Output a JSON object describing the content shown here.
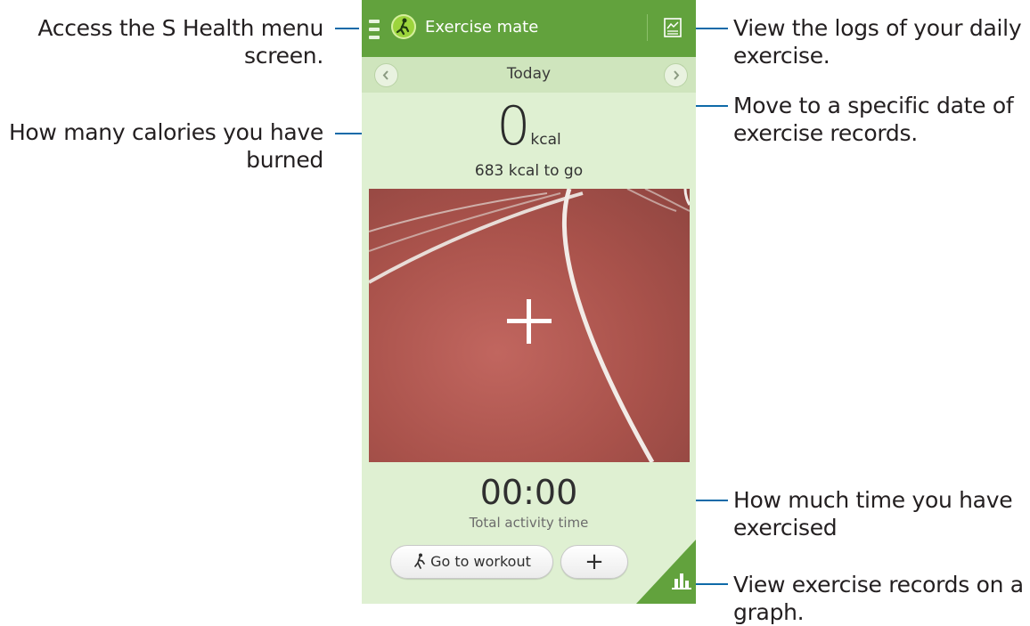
{
  "app": {
    "title": "Exercise mate",
    "accent_color": "#62a23d"
  },
  "date_bar": {
    "label": "Today",
    "prev_icon": "chevron-left-icon",
    "next_icon": "chevron-right-icon"
  },
  "calories": {
    "value": "0",
    "unit": "kcal",
    "to_go": "683 kcal to go"
  },
  "activity": {
    "time": "00:00",
    "label": "Total activity time"
  },
  "buttons": {
    "go_to_workout": "Go to workout",
    "add": "+"
  },
  "callouts": {
    "menu": [
      "Access the S Health menu",
      "screen."
    ],
    "calories": [
      "How many calories you have",
      "burned"
    ],
    "logs": [
      "View the logs of your daily",
      "exercise."
    ],
    "date": [
      "Move to a specific date of",
      "exercise records."
    ],
    "time": [
      "How much time you have",
      "exercised"
    ],
    "graph": [
      "View exercise records on a",
      "graph."
    ]
  },
  "icons": [
    "menu-icon",
    "runner-icon",
    "log-chart-icon",
    "plus-icon",
    "bar-chart-icon",
    "walking-person-icon"
  ]
}
